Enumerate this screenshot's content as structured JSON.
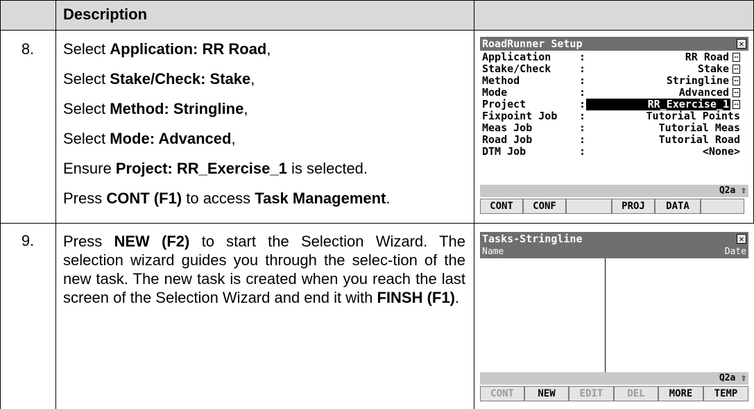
{
  "table": {
    "header": "Description",
    "step8": {
      "number": "8.",
      "lines": [
        {
          "pre": "Select ",
          "bold": "Application: RR Road",
          "post": ","
        },
        {
          "pre": "Select ",
          "bold": "Stake/Check: Stake",
          "post": ","
        },
        {
          "pre": "Select ",
          "bold": "Method: Stringline",
          "post": ","
        },
        {
          "pre": "Select ",
          "bold": "Mode: Advanced",
          "post": ","
        },
        {
          "pre": "Ensure ",
          "bold": "Project: RR_Exercise_1",
          "post": " is selected."
        }
      ],
      "last": {
        "pre": "Press ",
        "bold1": "CONT (F1)",
        "mid": " to access ",
        "bold2": "Task Management",
        "post": "."
      }
    },
    "step9": {
      "number": "9.",
      "pre": "Press ",
      "bold1": "NEW (F2)",
      "mid": " to start the Selection Wizard. The selection wizard guides you through the selec-tion of the new task. The new task is created when you reach the last screen of the Selection Wizard and end it with ",
      "bold2": "FINSH (F1)",
      "post": "."
    }
  },
  "screen1": {
    "title": "RoadRunner Setup",
    "close_glyph": "✕",
    "rows": [
      {
        "label": "Application",
        "value": "RR Road"
      },
      {
        "label": "Stake/Check",
        "value": "Stake"
      },
      {
        "label": "Method",
        "value": "Stringline"
      },
      {
        "label": "Mode",
        "value": "Advanced"
      },
      {
        "label": "Project",
        "value": "RR_Exercise_1"
      },
      {
        "label": "Fixpoint Job",
        "value": "Tutorial Points"
      },
      {
        "label": "Meas Job",
        "value": "Tutorial Meas"
      },
      {
        "label": "Road Job",
        "value": "Tutorial Road"
      },
      {
        "label": "DTM Job",
        "value": "<None>"
      }
    ],
    "colon": ":",
    "arrow_glyph": "◂▸",
    "status": "Q2a ⇧",
    "keys": [
      "CONT",
      "CONF",
      "",
      "PROJ",
      "DATA",
      ""
    ]
  },
  "screen2": {
    "title": "Tasks-Stringline",
    "close_glyph": "✕",
    "col_name": "Name",
    "col_date": "Date",
    "status": "Q2a ⇧",
    "keys": [
      "CONT",
      "NEW",
      "EDIT",
      "DEL",
      "MORE",
      "TEMP"
    ],
    "disabled_keys": [
      "CONT",
      "EDIT",
      "DEL"
    ]
  }
}
